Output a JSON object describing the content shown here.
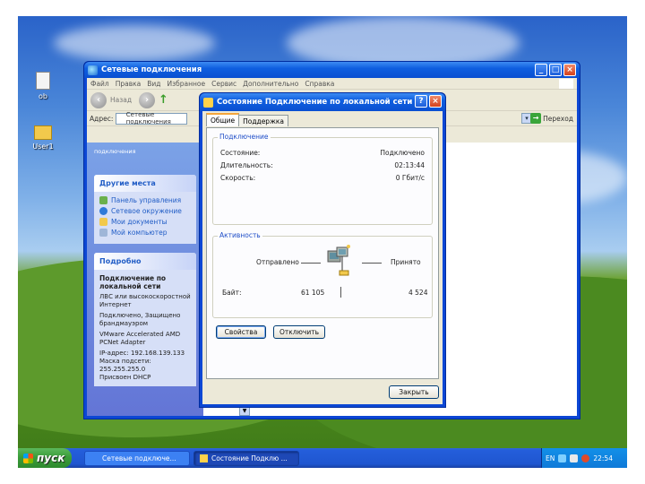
{
  "desktop": {
    "icons": [
      {
        "label": "ob"
      },
      {
        "label": "User1"
      }
    ]
  },
  "explorer": {
    "title": "Сетевые подключения",
    "menu": [
      "Файл",
      "Правка",
      "Вид",
      "Избранное",
      "Сервис",
      "Дополнительно",
      "Справка"
    ],
    "back_label": "Назад",
    "address_label": "Адрес:",
    "address_value": "Сетевые подключения",
    "go_label": "Переход",
    "left_top_text": "подключения",
    "other_places": {
      "header": "Другие места",
      "items": [
        "Панель управления",
        "Сетевое окружение",
        "Мои документы",
        "Мой компьютер"
      ]
    },
    "details": {
      "header": "Подробно",
      "name": "Подключение по локальной сети",
      "type": "ЛВС или высокоскоростной Интернет",
      "status": "Подключено, Защищено брандмауэром",
      "adapter": "VMware Accelerated AMD PCNet Adapter",
      "ip": "IP-адрес: 192.168.139.133",
      "mask": "Маска подсети: 255.255.255.0",
      "dhcp": "Присвоен DHCP"
    }
  },
  "dialog": {
    "title": "Состояние Подключение по локальной сети",
    "tabs": [
      "Общие",
      "Поддержка"
    ],
    "connection": {
      "legend": "Подключение",
      "rows": [
        {
          "label": "Состояние:",
          "value": "Подключено"
        },
        {
          "label": "Длительность:",
          "value": "02:13:44"
        },
        {
          "label": "Скорость:",
          "value": "0 Гбит/с"
        }
      ]
    },
    "activity": {
      "legend": "Активность",
      "sent_label": "Отправлено",
      "received_label": "Принято",
      "bytes_label": "Байт:",
      "sent_bytes": "61 105",
      "received_bytes": "4 524"
    },
    "properties_button": "Свойства",
    "disable_button": "Отключить",
    "close_button": "Закрыть"
  },
  "taskbar": {
    "start_label": "пуск",
    "tasks": [
      "Сетевые подключе...",
      "Состояние Подклю ..."
    ],
    "lang": "EN",
    "clock": "22:54"
  }
}
